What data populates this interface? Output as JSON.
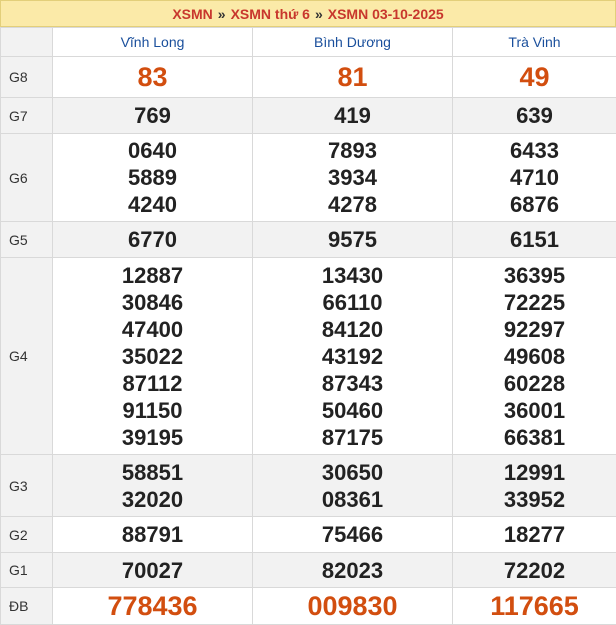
{
  "breadcrumb": {
    "item1": "XSMN",
    "item2": "XSMN thứ 6",
    "item3": "XSMN 03-10-2025",
    "separator": "»"
  },
  "provinces": [
    "Vĩnh Long",
    "Bình Dương",
    "Trà Vinh"
  ],
  "prizes": [
    {
      "label": "G8",
      "values": [
        [
          "83"
        ],
        [
          "81"
        ],
        [
          "49"
        ]
      ]
    },
    {
      "label": "G7",
      "values": [
        [
          "769"
        ],
        [
          "419"
        ],
        [
          "639"
        ]
      ]
    },
    {
      "label": "G6",
      "values": [
        [
          "0640",
          "5889",
          "4240"
        ],
        [
          "7893",
          "3934",
          "4278"
        ],
        [
          "6433",
          "4710",
          "6876"
        ]
      ]
    },
    {
      "label": "G5",
      "values": [
        [
          "6770"
        ],
        [
          "9575"
        ],
        [
          "6151"
        ]
      ]
    },
    {
      "label": "G4",
      "values": [
        [
          "12887",
          "30846",
          "47400",
          "35022",
          "87112",
          "91150",
          "39195"
        ],
        [
          "13430",
          "66110",
          "84120",
          "43192",
          "87343",
          "50460",
          "87175"
        ],
        [
          "36395",
          "72225",
          "92297",
          "49608",
          "60228",
          "36001",
          "66381"
        ]
      ]
    },
    {
      "label": "G3",
      "values": [
        [
          "58851",
          "32020"
        ],
        [
          "30650",
          "08361"
        ],
        [
          "12991",
          "33952"
        ]
      ]
    },
    {
      "label": "G2",
      "values": [
        [
          "88791"
        ],
        [
          "75466"
        ],
        [
          "18277"
        ]
      ]
    },
    {
      "label": "G1",
      "values": [
        [
          "70027"
        ],
        [
          "82023"
        ],
        [
          "72202"
        ]
      ]
    },
    {
      "label": "ĐB",
      "values": [
        [
          "778436"
        ],
        [
          "009830"
        ],
        [
          "117665"
        ]
      ]
    }
  ],
  "colors": {
    "accent": "#c8372d",
    "highlight": "#d24e0f",
    "header_text": "#1a4f9c",
    "title_bg": "#fbeaa8"
  }
}
